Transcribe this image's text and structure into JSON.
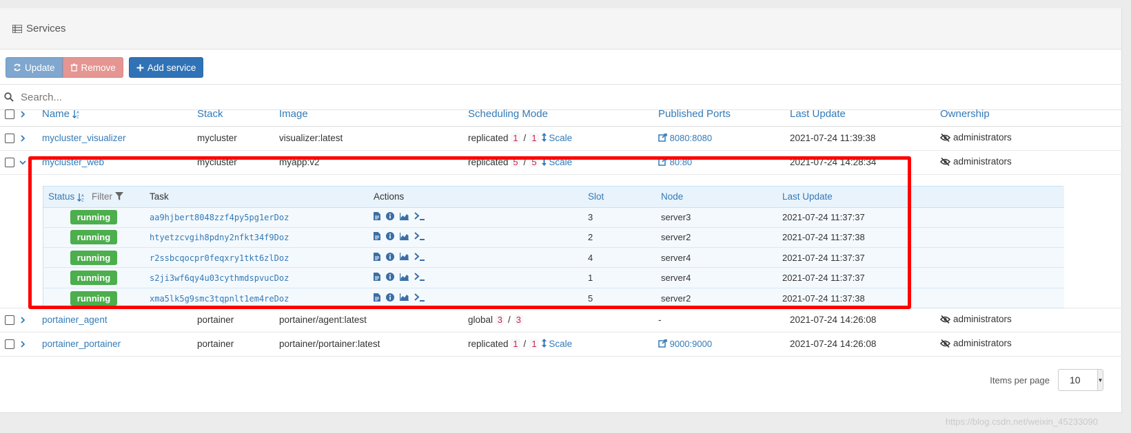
{
  "panel": {
    "title": "Services",
    "title_icon": "list-icon"
  },
  "toolbar": {
    "update_label": "Update",
    "remove_label": "Remove",
    "add_label": "Add service"
  },
  "search": {
    "placeholder": "Search..."
  },
  "table": {
    "headers": {
      "name": "Name",
      "stack": "Stack",
      "image": "Image",
      "scheduling": "Scheduling Mode",
      "ports": "Published Ports",
      "last_update": "Last Update",
      "ownership": "Ownership"
    },
    "rows": [
      {
        "name": "mycluster_visualizer",
        "stack": "mycluster",
        "image": "visualizer:latest",
        "mode": "replicated",
        "running": "1",
        "desired": "1",
        "scale": "Scale",
        "port": "8080:8080",
        "last_update": "2021-07-24 11:39:38",
        "ownership": "administrators"
      },
      {
        "name": "mycluster_web",
        "stack": "mycluster",
        "image": "myapp:v2",
        "mode": "replicated",
        "running": "5",
        "desired": "5",
        "scale": "Scale",
        "port": "80:80",
        "last_update": "2021-07-24 14:28:34",
        "ownership": "administrators"
      },
      {
        "name": "portainer_agent",
        "stack": "portainer",
        "image": "portainer/agent:latest",
        "mode": "global",
        "running": "3",
        "desired": "3",
        "port": "-",
        "last_update": "2021-07-24 14:26:08",
        "ownership": "administrators"
      },
      {
        "name": "portainer_portainer",
        "stack": "portainer",
        "image": "portainer/portainer:latest",
        "mode": "replicated",
        "running": "1",
        "desired": "1",
        "scale": "Scale",
        "port": "9000:9000",
        "last_update": "2021-07-24 14:26:08",
        "ownership": "administrators"
      }
    ]
  },
  "tasks": {
    "headers": {
      "status": "Status",
      "filter": "Filter",
      "task": "Task",
      "actions": "Actions",
      "slot": "Slot",
      "node": "Node",
      "last_update": "Last Update"
    },
    "rows": [
      {
        "status": "running",
        "task": "aa9hjbert8048zzf4py5pg1erDoz",
        "slot": "3",
        "node": "server3",
        "last_update": "2021-07-24 11:37:37"
      },
      {
        "status": "running",
        "task": "htyetzcvgih8pdny2nfkt34f9Doz",
        "slot": "2",
        "node": "server2",
        "last_update": "2021-07-24 11:37:38"
      },
      {
        "status": "running",
        "task": "r2ssbcqocpr0feqxry1tkt6zlDoz",
        "slot": "4",
        "node": "server4",
        "last_update": "2021-07-24 11:37:37"
      },
      {
        "status": "running",
        "task": "s2ji3wf6qy4u03cythmdspvucDoz",
        "slot": "1",
        "node": "server4",
        "last_update": "2021-07-24 11:37:37"
      },
      {
        "status": "running",
        "task": "xma5lk5g9smc3tqpnlt1em4reDoz",
        "slot": "5",
        "node": "server2",
        "last_update": "2021-07-24 11:37:38"
      }
    ]
  },
  "pagination": {
    "label": "Items per page",
    "value": "10"
  },
  "watermark": "https://blog.csdn.net/weixin_45233090",
  "colors": {
    "link": "#337ab7",
    "running": "#4cae4c",
    "highlight": "#ff0000",
    "update_btn": "#7fa7cf",
    "remove_btn": "#e59592",
    "add_btn": "#3072b6"
  }
}
